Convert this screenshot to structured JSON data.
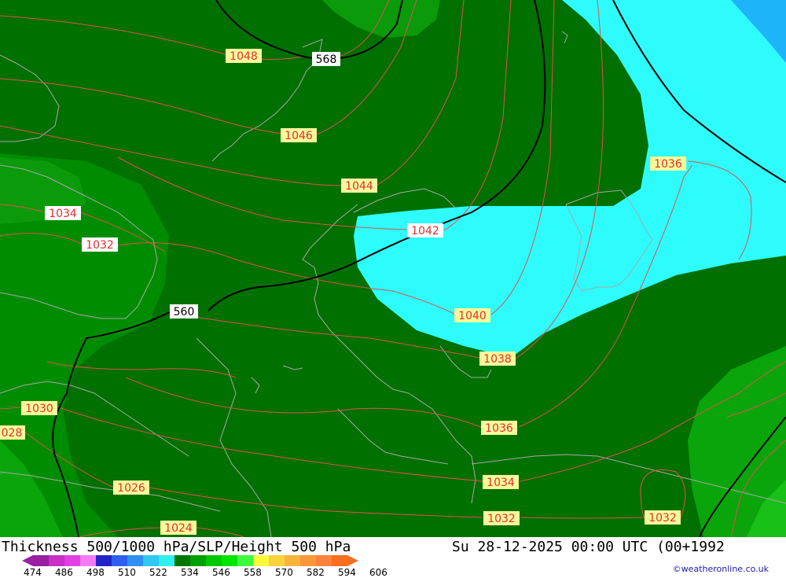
{
  "map": {
    "colors": {
      "green_light": "#0aa50a",
      "green_dark": "#007000",
      "green_mid": "#008c00",
      "cyan": "#2efcfc",
      "blue": "#1eb4fa",
      "isobar": "#e05050",
      "thickness_line": "#000000",
      "coast": "#a8a8a8"
    },
    "isobar_labels": [
      "1048",
      "1046",
      "1044",
      "1042",
      "1040",
      "1038",
      "1036",
      "1036",
      "1036",
      "1034",
      "1034",
      "1032",
      "1032",
      "1032",
      "1030",
      "028",
      "1026",
      "1024"
    ],
    "thickness_labels": [
      "568",
      "560"
    ]
  },
  "footer": {
    "title": "Thickness 500/1000 hPa/SLP/Height 500 hPa",
    "timestamp": "Su 28-12-2025 00:00 UTC (00+1992",
    "credit": "©weatheronline.co.uk",
    "scale_values": [
      "474",
      "486",
      "498",
      "510",
      "522",
      "534",
      "546",
      "558",
      "570",
      "582",
      "594",
      "606"
    ],
    "scale_colors": [
      "#9b1fa3",
      "#c72fc7",
      "#e23fe2",
      "#f37bf3",
      "#2323c8",
      "#2f5ff0",
      "#2f90f0",
      "#2fc8f0",
      "#2ff0f0",
      "#007800",
      "#00a000",
      "#00c800",
      "#00e600",
      "#3cfa3c",
      "#fafa3c",
      "#fad23c",
      "#fab43c",
      "#fa963c",
      "#fa823c",
      "#fa6e1e"
    ]
  }
}
